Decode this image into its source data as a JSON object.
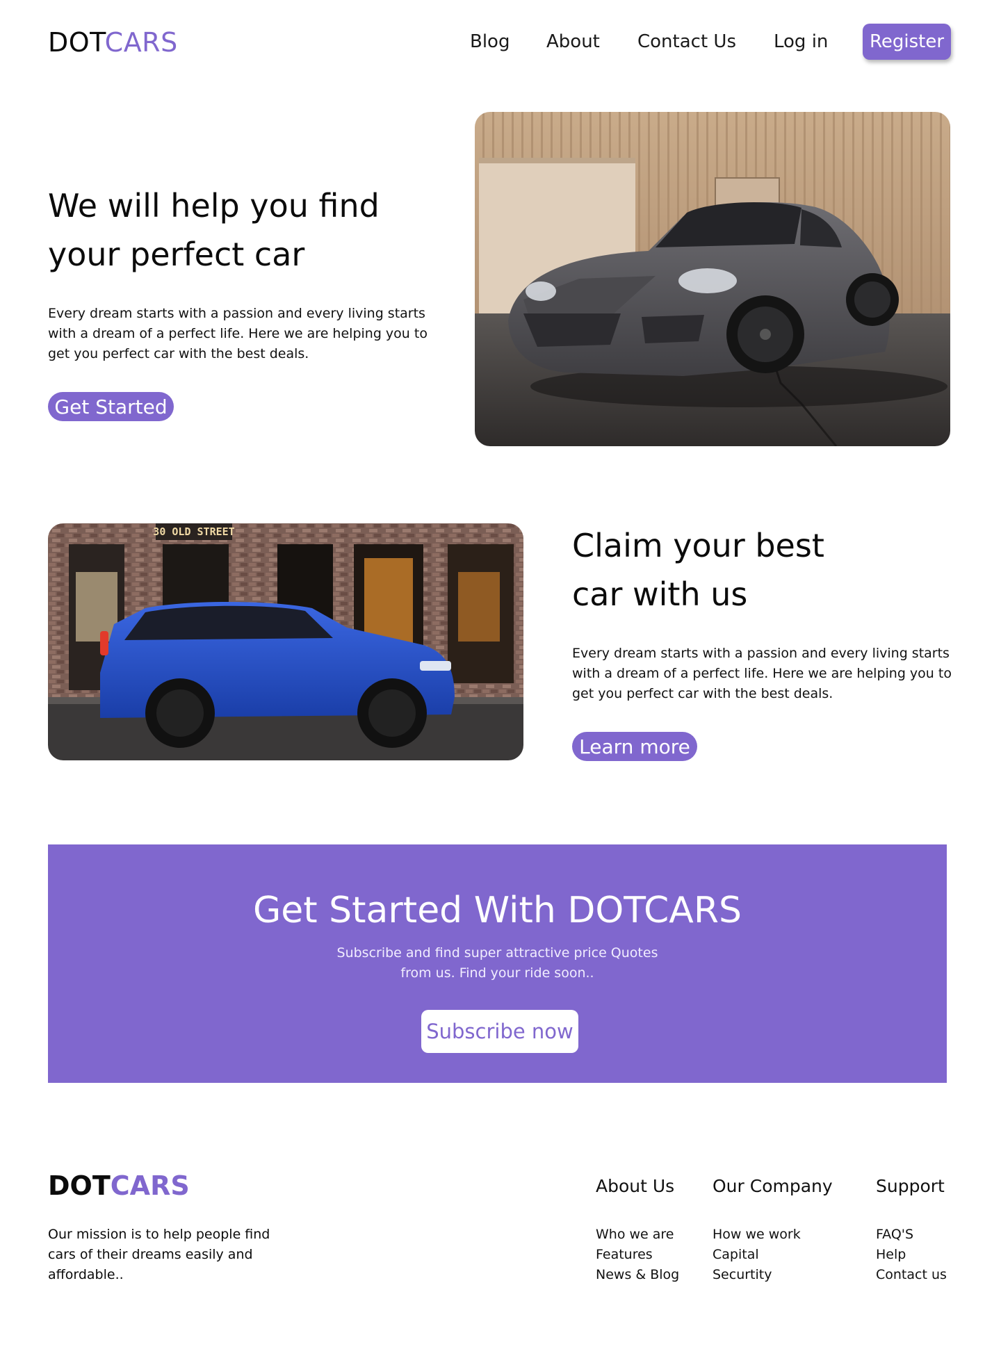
{
  "header": {
    "logo_dark": "DOT",
    "logo_accent": "CARS",
    "nav": [
      "Blog",
      "About",
      "Contact Us",
      "Log in"
    ],
    "register_label": "Register"
  },
  "hero": {
    "title_line1": "We will help you find",
    "title_line2": "your perfect car",
    "desc_line1": "Every dream starts with a passion and every living starts",
    "desc_line2": "with a dream of a perfect life. Here we are helping you to",
    "desc_line3": "get you perfect car with the best deals.",
    "button_label": "Get Started"
  },
  "claim": {
    "title_line1": "Claim your best",
    "title_line2": "car with us",
    "desc_line1": "Every dream starts with a passion and every living starts",
    "desc_line2": "with a dream of a perfect life. Here we are helping you to",
    "desc_line3": "get you perfect car with the best deals.",
    "button_label": "Learn more",
    "storefront_sign": "30 OLD STREET"
  },
  "cta": {
    "title": "Get Started With DOTCARS",
    "subtitle_line1": "Subscribe and find super attractive price Quotes",
    "subtitle_line2": "from us. Find your ride soon..",
    "button_label": "Subscribe now"
  },
  "footer": {
    "logo_dark": "DOT",
    "logo_accent": "CARS",
    "mission_line1": "Our mission is to help people find",
    "mission_line2": "cars of their dreams easily and",
    "mission_line3": "affordable..",
    "columns": [
      {
        "heading": "About Us",
        "links": [
          "Who we are",
          "Features",
          "News & Blog"
        ]
      },
      {
        "heading": "Our Company",
        "links": [
          "How we work",
          "Capital",
          "Securtity"
        ]
      },
      {
        "heading": "Support",
        "links": [
          "FAQ'S",
          "Help",
          "Contact us"
        ]
      }
    ]
  },
  "colors": {
    "accent": "#8067ce",
    "text": "#0b0b0b",
    "background": "#ffffff"
  }
}
